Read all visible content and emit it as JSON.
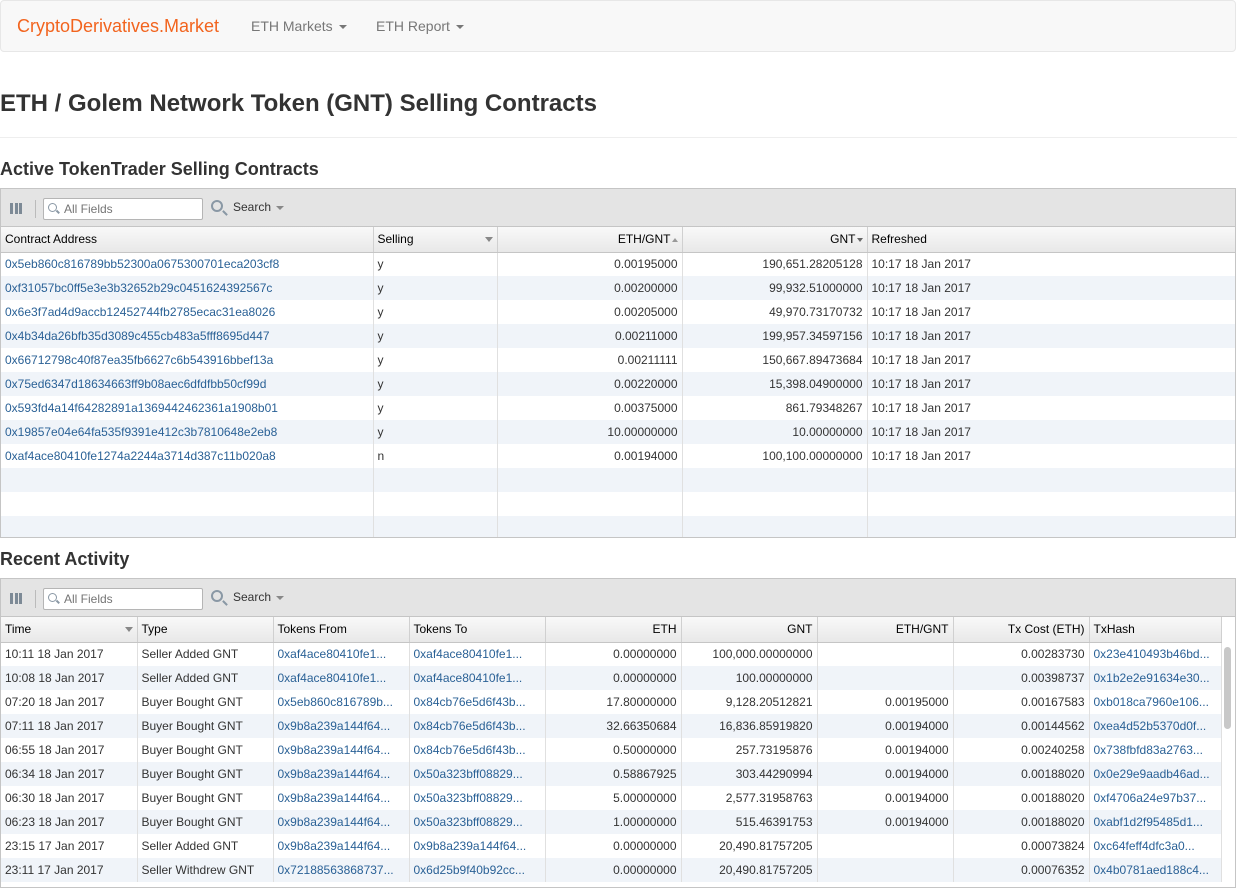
{
  "navbar": {
    "brand": "CryptoDerivatives.Market",
    "menus": [
      "ETH Markets",
      "ETH Report"
    ]
  },
  "page_title": "ETH / Golem Network Token (GNT) Selling Contracts",
  "active": {
    "title": "Active TokenTrader Selling Contracts",
    "search_placeholder": "All Fields",
    "search_label": "Search",
    "columns": [
      "Contract Address",
      "Selling",
      "ETH/GNT",
      "GNT",
      "Refreshed"
    ],
    "rows": [
      [
        "0x5eb860c816789bb52300a0675300701eca203cf8",
        "y",
        "0.00195000",
        "190,651.28205128",
        "10:17 18 Jan 2017"
      ],
      [
        "0xf31057bc0ff5e3e3b32652b29c0451624392567c",
        "y",
        "0.00200000",
        "99,932.51000000",
        "10:17 18 Jan 2017"
      ],
      [
        "0x6e3f7ad4d9accb12452744fb2785ecac31ea8026",
        "y",
        "0.00205000",
        "49,970.73170732",
        "10:17 18 Jan 2017"
      ],
      [
        "0x4b34da26bfb35d3089c455cb483a5fff8695d447",
        "y",
        "0.00211000",
        "199,957.34597156",
        "10:17 18 Jan 2017"
      ],
      [
        "0x66712798c40f87ea35fb6627c6b543916bbef13a",
        "y",
        "0.00211111",
        "150,667.89473684",
        "10:17 18 Jan 2017"
      ],
      [
        "0x75ed6347d18634663ff9b08aec6dfdfbb50cf99d",
        "y",
        "0.00220000",
        "15,398.04900000",
        "10:17 18 Jan 2017"
      ],
      [
        "0x593fd4a14f64282891a1369442462361a1908b01",
        "y",
        "0.00375000",
        "861.79348267",
        "10:17 18 Jan 2017"
      ],
      [
        "0x19857e04e64fa535f9391e412c3b7810648e2eb8",
        "y",
        "10.00000000",
        "10.00000000",
        "10:17 18 Jan 2017"
      ],
      [
        "0xaf4ace80410fe1274a2244a3714d387c11b020a8",
        "n",
        "0.00194000",
        "100,100.00000000",
        "10:17 18 Jan 2017"
      ]
    ]
  },
  "recent": {
    "title": "Recent Activity",
    "search_placeholder": "All Fields",
    "search_label": "Search",
    "columns": [
      "Time",
      "Type",
      "Tokens From",
      "Tokens To",
      "ETH",
      "GNT",
      "ETH/GNT",
      "Tx Cost (ETH)",
      "TxHash"
    ],
    "rows": [
      [
        "10:11 18 Jan 2017",
        "Seller Added GNT",
        "0xaf4ace80410fe1...",
        "0xaf4ace80410fe1...",
        "0.00000000",
        "100,000.00000000",
        "",
        "0.00283730",
        "0x23e410493b46bd..."
      ],
      [
        "10:08 18 Jan 2017",
        "Seller Added GNT",
        "0xaf4ace80410fe1...",
        "0xaf4ace80410fe1...",
        "0.00000000",
        "100.00000000",
        "",
        "0.00398737",
        "0x1b2e2e91634e30..."
      ],
      [
        "07:20 18 Jan 2017",
        "Buyer Bought GNT",
        "0x5eb860c816789b...",
        "0x84cb76e5d6f43b...",
        "17.80000000",
        "9,128.20512821",
        "0.00195000",
        "0.00167583",
        "0xb018ca7960e106..."
      ],
      [
        "07:11 18 Jan 2017",
        "Buyer Bought GNT",
        "0x9b8a239a144f64...",
        "0x84cb76e5d6f43b...",
        "32.66350684",
        "16,836.85919820",
        "0.00194000",
        "0.00144562",
        "0xea4d52b5370d0f..."
      ],
      [
        "06:55 18 Jan 2017",
        "Buyer Bought GNT",
        "0x9b8a239a144f64...",
        "0x84cb76e5d6f43b...",
        "0.50000000",
        "257.73195876",
        "0.00194000",
        "0.00240258",
        "0x738fbfd83a2763..."
      ],
      [
        "06:34 18 Jan 2017",
        "Buyer Bought GNT",
        "0x9b8a239a144f64...",
        "0x50a323bff08829...",
        "0.58867925",
        "303.44290994",
        "0.00194000",
        "0.00188020",
        "0x0e29e9aadb46ad..."
      ],
      [
        "06:30 18 Jan 2017",
        "Buyer Bought GNT",
        "0x9b8a239a144f64...",
        "0x50a323bff08829...",
        "5.00000000",
        "2,577.31958763",
        "0.00194000",
        "0.00188020",
        "0xf4706a24e97b37..."
      ],
      [
        "06:23 18 Jan 2017",
        "Buyer Bought GNT",
        "0x9b8a239a144f64...",
        "0x50a323bff08829...",
        "1.00000000",
        "515.46391753",
        "0.00194000",
        "0.00188020",
        "0xabf1d2f95485d1..."
      ],
      [
        "23:15 17 Jan 2017",
        "Seller Added GNT",
        "0x9b8a239a144f64...",
        "0x9b8a239a144f64...",
        "0.00000000",
        "20,490.81757205",
        "",
        "0.00073824",
        "0xc64feff4dfc3a0..."
      ],
      [
        "23:11 17 Jan 2017",
        "Seller Withdrew GNT",
        "0x72188563868737...",
        "0x6d25b9f40b92cc...",
        "0.00000000",
        "20,490.81757205",
        "",
        "0.00076352",
        "0x4b0781aed188c4..."
      ]
    ]
  }
}
